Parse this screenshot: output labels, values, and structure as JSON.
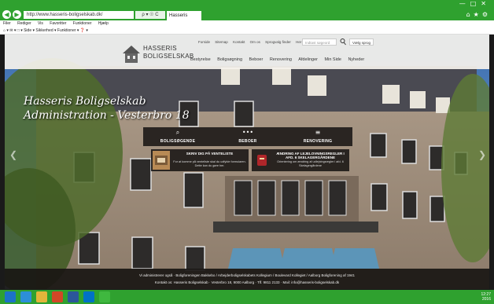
{
  "browser": {
    "address": "http://www.hasseris-boligselskab.dk/",
    "address_controls": "ρ ▾ ☉ C",
    "tab_title": "Hasseris",
    "menubar": [
      "Filer",
      "Rediger",
      "Vis",
      "Favoritter",
      "Funktioner",
      "Hjælp"
    ],
    "favbar": "⌂ ▾ ✉ ▾ □ ▾ Side ▾ Sikkerhed ▾ Funktioner ▾ ❓ ▾"
  },
  "site": {
    "brand_line1": "HASSERIS",
    "brand_line2": "BOLIGSELSKAB",
    "top_links": [
      "Forside",
      "Sitemap",
      "Kontakt",
      "Om os",
      "Sprogvalg finder",
      "Her afdeling"
    ],
    "search_placeholder": "Indtast søgeord",
    "language": "Vælg sprog",
    "nav": [
      "Bestyrelse",
      "Boligsøgning",
      "Beboer",
      "Renovering",
      "Afdelinger",
      "Min Side",
      "Nyheder"
    ]
  },
  "hero": {
    "title_line1": "Hasseris Boligselskab",
    "title_line2": "Administration - Vesterbro 18"
  },
  "tiles": [
    {
      "icon": "search-icon",
      "glyph": "⌕",
      "label": "BOLIGSØGENDE"
    },
    {
      "icon": "dots-icon",
      "glyph": "•••",
      "label": "BEBOER"
    },
    {
      "icon": "menu-icon",
      "glyph": "≡",
      "label": "RENOVERING"
    }
  ],
  "news": [
    {
      "title": "SKRIV DIG PÅ VENTELISTE",
      "text": "For at komme på venteliste skal du udfylde formularen. Dette kan du gøre her."
    },
    {
      "title": "ÆNDRING AF LEJELOVNINGSREGLER I AFD. 6 SKELAGERGÅRDENE",
      "text": "Orientering om ændring af udlejningsregler i afd. 6 Skelagergårdene"
    }
  ],
  "footer": {
    "line1": "Vi administrerer også · Boligforeningen Bakkebo / Arbejderboligselskabets Kollegium / Boulevard Kollegiet / Aalborg Boligforening af 1941",
    "line2": "Kontakt os: Hasseris Boligselskab · Vesterbro 18, 9000 Aalborg · Tlf. 9811 2133 · Mail: info@hasseris-boligselskab.dk"
  },
  "tray": {
    "time": "12:27",
    "date": "2016"
  },
  "colors": {
    "chrome_green": "#2fa12f",
    "tile_bg": "#191614",
    "header_bg": "#f5f2ec"
  }
}
